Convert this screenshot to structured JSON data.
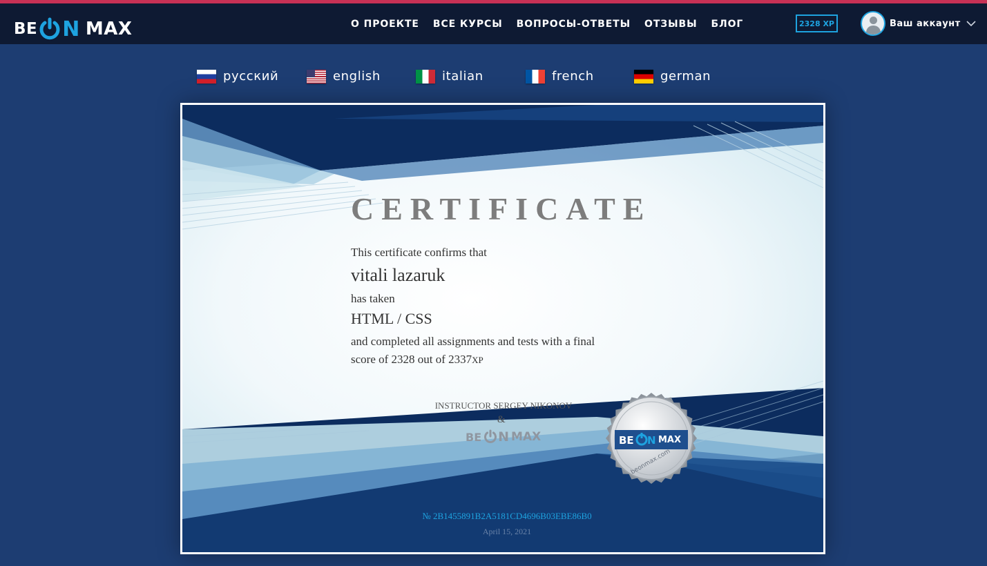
{
  "header": {
    "logo": {
      "be": "BE",
      "on": "ON",
      "max": "MAX"
    },
    "nav": [
      {
        "label": "О ПРОЕКТЕ"
      },
      {
        "label": "ВСЕ КУРСЫ"
      },
      {
        "label": "ВОПРОСЫ-ОТВЕТЫ"
      },
      {
        "label": "ОТЗЫВЫ"
      },
      {
        "label": "БЛОГ"
      }
    ],
    "xp_badge": "2328 XP",
    "account_label": "Ваш аккаунт"
  },
  "languages": [
    {
      "label": "русский",
      "flag": "ru"
    },
    {
      "label": "english",
      "flag": "us"
    },
    {
      "label": "italian",
      "flag": "it"
    },
    {
      "label": "french",
      "flag": "fr"
    },
    {
      "label": "german",
      "flag": "de"
    }
  ],
  "certificate": {
    "title": "CERTIFICATE",
    "confirms": "This certificate confirms that",
    "name": "vitali lazaruk",
    "has_taken": "has taken",
    "course": "HTML / CSS",
    "completed_line1": "and completed all assignments and tests with a final",
    "completed_line2": "score of 2328 out of 2337",
    "xp_unit": "XP",
    "instructor": "INSTRUCTOR SERGEY NIKONOV",
    "ampersand": "&",
    "mini_logo": {
      "be": "BE",
      "on": "ON",
      "max": "MAX"
    },
    "seal": {
      "be": "BE",
      "on": "ON",
      "max": "MAX",
      "url": "beonmax.com"
    },
    "serial": "№ 2B1455891B2A5181CD4696B03EBE86B0",
    "date": "April 15, 2021"
  },
  "colors": {
    "accent": "#1ea3e0",
    "header_bg": "#0e1a33",
    "page_bg": "#1d3d72",
    "top_line": "#c73155"
  }
}
